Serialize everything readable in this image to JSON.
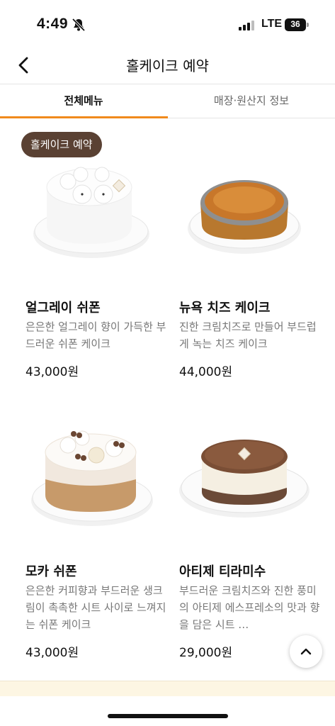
{
  "status_bar": {
    "time": "4:49",
    "network": "LTE",
    "battery_level": "36"
  },
  "header": {
    "title": "홀케이크 예약",
    "back_icon": "chevron-left-icon"
  },
  "tabs": [
    {
      "label": "전체메뉴",
      "active": true
    },
    {
      "label": "매장·원산지 정보",
      "active": false
    }
  ],
  "category_badge": "홀케이크 예약",
  "products": [
    {
      "name": "얼그레이 쉬폰",
      "desc": "은은한 얼그레이 향이 가득한 부드러운 쉬폰 케이크",
      "price": "43,000원"
    },
    {
      "name": "뉴욕 치즈 케이크",
      "desc": "진한 크림치즈로 만들어 부드럽게 녹는 치즈 케이크",
      "price": "44,000원"
    },
    {
      "name": "모카 쉬폰",
      "desc": "은은한 커피향과 부드러운 생크림이 촉촉한 시트 사이로 느껴지는 쉬폰 케이크",
      "price": "43,000원"
    },
    {
      "name": "아티제 티라미수",
      "desc": "부드러운 크림치즈와 진한 풍미의 아티제 에스프레소의 맛과 향을 담은 시트 …",
      "price": "29,000원"
    }
  ],
  "colors": {
    "accent": "#f08a1c",
    "badge": "#5a4133"
  },
  "scroll_top_icon": "chevron-up-icon"
}
